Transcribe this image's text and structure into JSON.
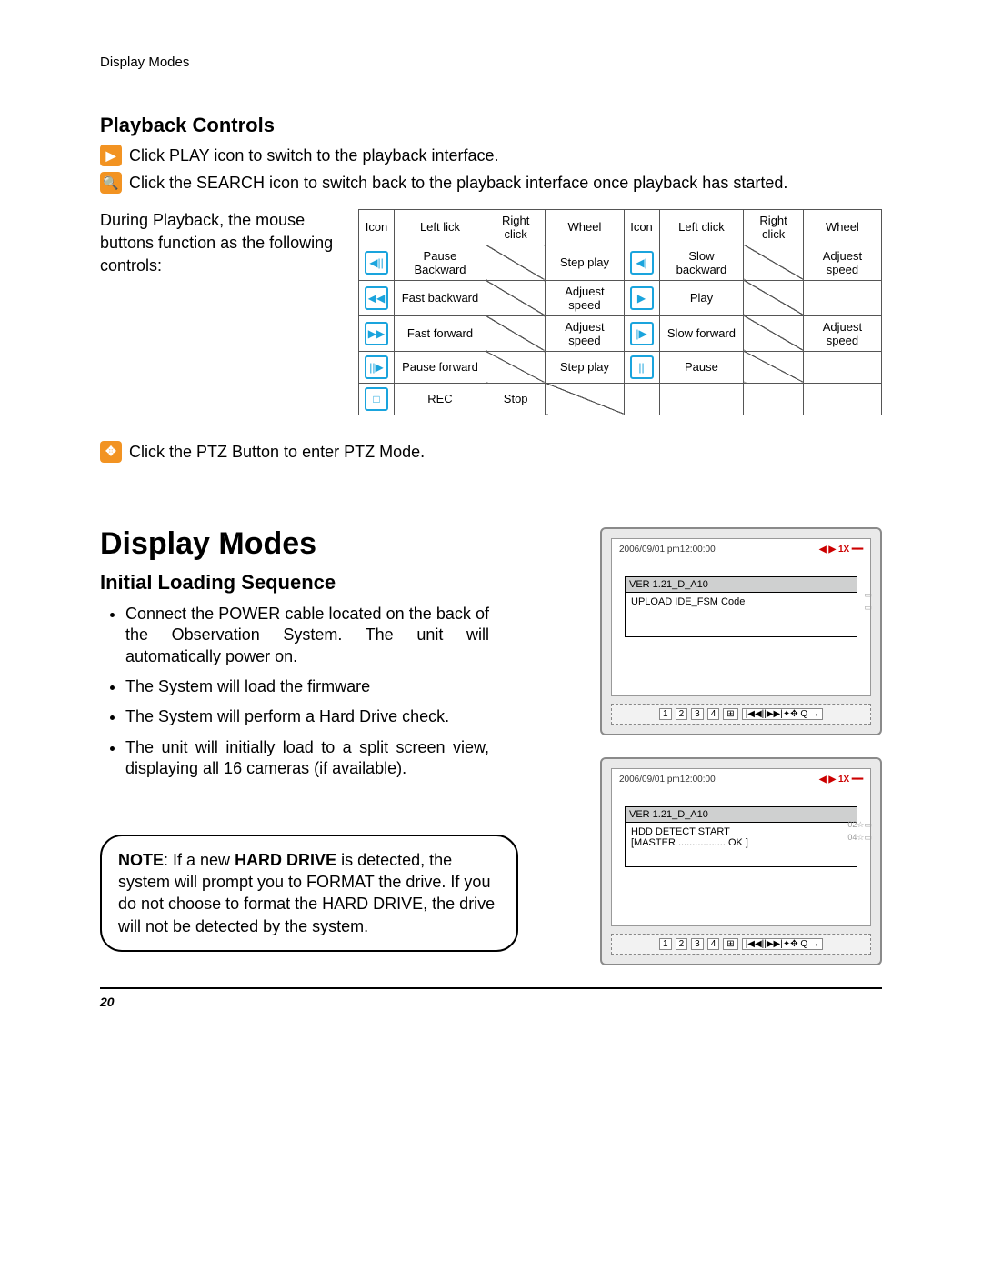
{
  "running_head": "Display Modes",
  "section1": {
    "title": "Playback Controls",
    "play_line": "Click PLAY icon to switch to the playback interface.",
    "search_line": "Click the SEARCH icon to switch back to the playback interface once playback has started.",
    "mouse_intro": "During Playback, the mouse buttons function as the following controls:",
    "ptz_line": "Click the PTZ Button to enter PTZ Mode.",
    "table": {
      "head": [
        "Icon",
        "Left lick",
        "Right click",
        "Wheel",
        "Icon",
        "Left click",
        "Right click",
        "Wheel"
      ],
      "rows": [
        {
          "a": "◀||",
          "b": "Pause Backward",
          "c": "/",
          "d": "Step play",
          "e": "◀|",
          "f": "Slow backward",
          "g": "/",
          "h": "Adjuest speed"
        },
        {
          "a": "◀◀",
          "b": "Fast backward",
          "c": "/",
          "d": "Adjuest speed",
          "e": "▶",
          "f": "Play",
          "g": "/",
          "h": ""
        },
        {
          "a": "▶▶",
          "b": "Fast forward",
          "c": "/",
          "d": "Adjuest speed",
          "e": "|▶",
          "f": "Slow forward",
          "g": "/",
          "h": "Adjuest speed"
        },
        {
          "a": "||▶",
          "b": "Pause forward",
          "c": "/",
          "d": "Step play",
          "e": "||",
          "f": "Pause",
          "g": "/",
          "h": ""
        },
        {
          "a": "□",
          "b": "REC",
          "c": "Stop",
          "d": "/",
          "e": "",
          "f": "",
          "g": "",
          "h": ""
        }
      ]
    }
  },
  "section2": {
    "title": "Display Modes",
    "sub": "Initial Loading Sequence",
    "bullets": [
      "Connect the POWER cable located on the back of the Observation System. The unit will automatically power on.",
      "The System will load the firmware",
      "The System will perform a Hard Drive check.",
      "The unit will initially load to a split screen view, displaying all 16 cameras (if available)."
    ],
    "note_pre": "NOTE",
    "note_strong": "HARD DRIVE",
    "note_text": ": If a new HARD DRIVE is detected, the system will prompt you to FORMAT the drive. If you do not choose to format the HARD DRIVE, the drive will not be detected by the system."
  },
  "monitors": {
    "timestamp": "2006/09/01 pm12:00:00",
    "speed": "◀ ▶ 1X ━━",
    "m1": {
      "title": "VER 1.21_D_A10",
      "body": "UPLOAD  IDE_FSM Code"
    },
    "m2": {
      "title": "VER 1.21_D_A10",
      "body1": "HDD DETECT START",
      "body2": "[MASTER ................. OK ]"
    },
    "btnbar": "1  2  3  4   |◀ ◀ || ▶ ▶| ✦ ✥  Q  →",
    "side": "02 ☆ ▭\n04 ☆ ▭"
  },
  "page_number": "20"
}
